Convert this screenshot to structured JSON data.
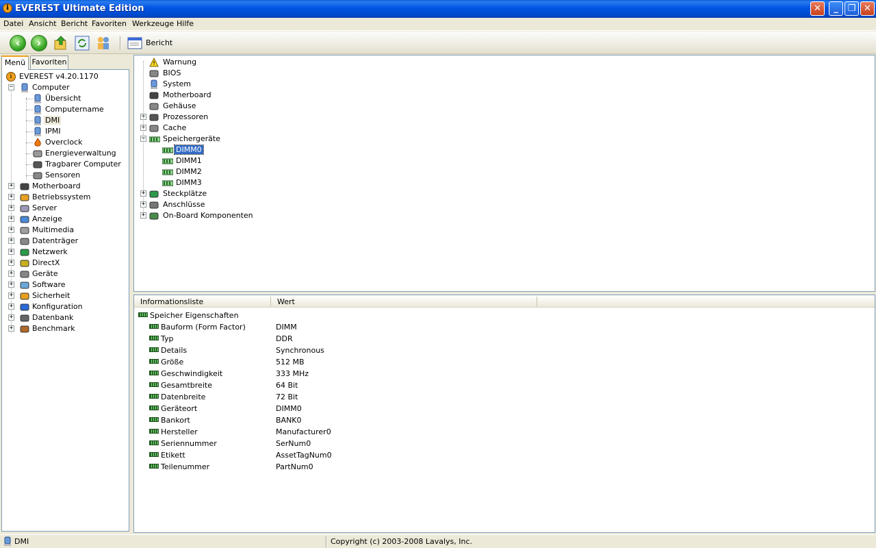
{
  "window": {
    "title": "EVEREST Ultimate Edition"
  },
  "menubar": {
    "items": [
      "Datei",
      "Ansicht",
      "Bericht",
      "Favoriten",
      "Werkzeuge",
      "Hilfe"
    ]
  },
  "toolbar": {
    "report_label": "Bericht"
  },
  "left_tabs": {
    "menu": "Menü",
    "favorites": "Favoriten"
  },
  "left_tree": {
    "root": "EVEREST v4.20.1170",
    "computer": "Computer",
    "computer_children": [
      "Übersicht",
      "Computername",
      "DMI",
      "IPMI",
      "Overclock",
      "Energieverwaltung",
      "Tragbarer Computer",
      "Sensoren"
    ],
    "groups": [
      "Motherboard",
      "Betriebssystem",
      "Server",
      "Anzeige",
      "Multimedia",
      "Datenträger",
      "Netzwerk",
      "DirectX",
      "Geräte",
      "Software",
      "Sicherheit",
      "Konfiguration",
      "Datenbank",
      "Benchmark"
    ]
  },
  "dmi_tree": {
    "items": [
      "Warnung",
      "BIOS",
      "System",
      "Motherboard",
      "Gehäuse",
      "Prozessoren",
      "Cache",
      "Speichergeräte"
    ],
    "dimms": [
      "DIMM0",
      "DIMM1",
      "DIMM2",
      "DIMM3"
    ],
    "after": [
      "Steckplätze",
      "Anschlüsse",
      "On-Board Komponenten"
    ]
  },
  "list": {
    "col_info": "Informationsliste",
    "col_value": "Wert",
    "group": "Speicher Eigenschaften",
    "rows": [
      {
        "k": "Bauform (Form Factor)",
        "v": "DIMM"
      },
      {
        "k": "Typ",
        "v": "DDR"
      },
      {
        "k": "Details",
        "v": "Synchronous"
      },
      {
        "k": "Größe",
        "v": "512 MB"
      },
      {
        "k": "Geschwindigkeit",
        "v": "333 MHz"
      },
      {
        "k": "Gesamtbreite",
        "v": "64 Bit"
      },
      {
        "k": "Datenbreite",
        "v": "72 Bit"
      },
      {
        "k": "Geräteort",
        "v": "DIMM0"
      },
      {
        "k": "Bankort",
        "v": "BANK0"
      },
      {
        "k": "Hersteller",
        "v": "Manufacturer0"
      },
      {
        "k": "Seriennummer",
        "v": "SerNum0"
      },
      {
        "k": "Etikett",
        "v": "AssetTagNum0"
      },
      {
        "k": "Teilenummer",
        "v": "PartNum0"
      }
    ]
  },
  "status": {
    "left": "DMI",
    "right": "Copyright (c) 2003-2008 Lavalys, Inc."
  }
}
